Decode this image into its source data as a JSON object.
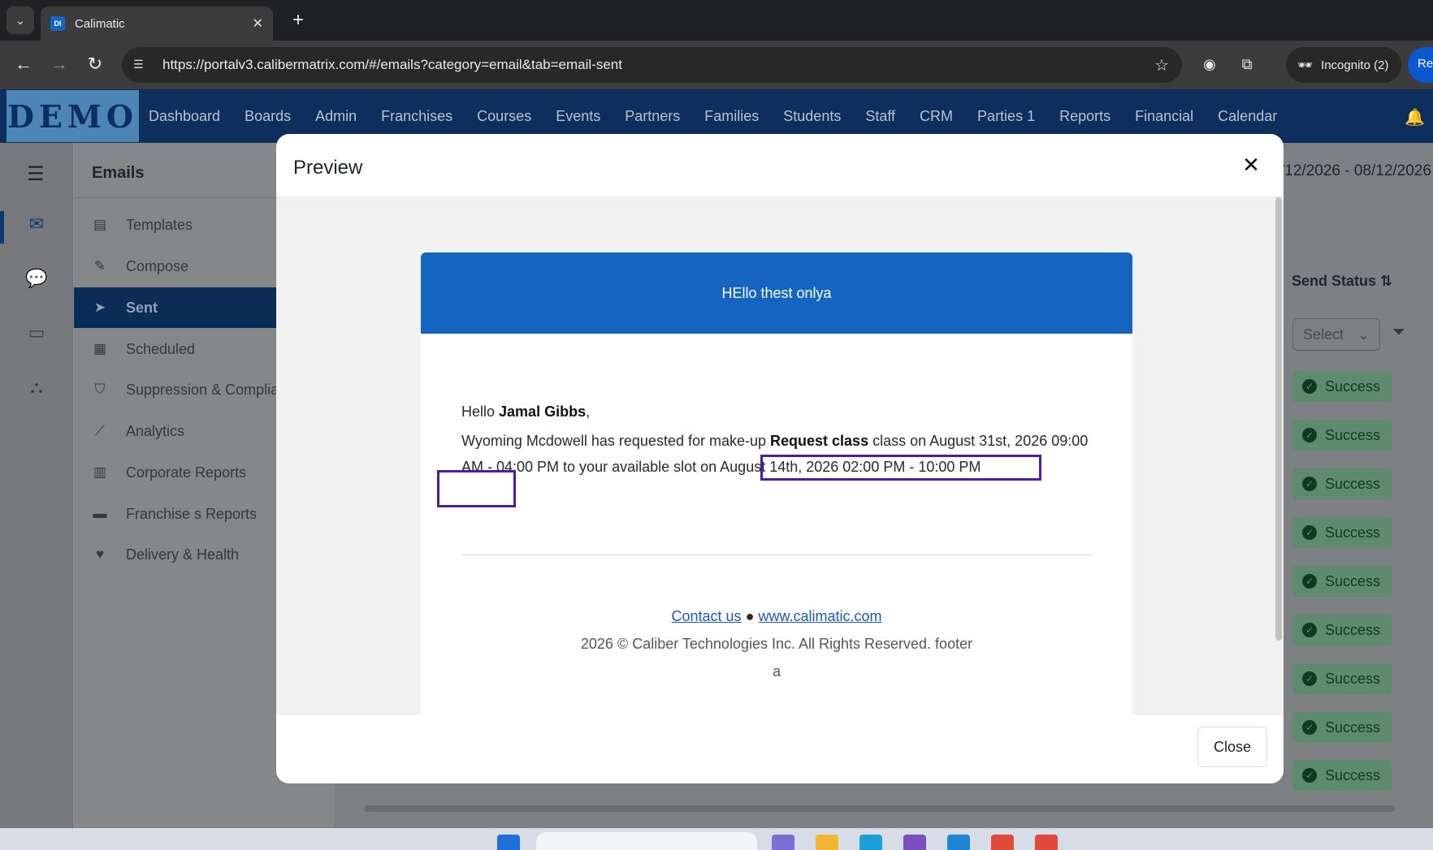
{
  "browser": {
    "tab_title": "Calimatic",
    "url": "https://portalv3.calibermatrix.com/#/emails?category=email&tab=email-sent",
    "incognito_label": "Incognito (2)",
    "relaunch_label": "Re"
  },
  "app": {
    "logo_text": "DEMO",
    "nav": [
      "Dashboard",
      "Boards",
      "Admin",
      "Franchises",
      "Courses",
      "Events",
      "Partners",
      "Families",
      "Students",
      "Staff",
      "CRM",
      "Parties 1",
      "Reports",
      "Financial",
      "Calendar"
    ]
  },
  "sidebar": {
    "title": "Emails",
    "items": [
      {
        "label": "Templates",
        "icon": "file-icon"
      },
      {
        "label": "Compose",
        "icon": "edit-icon"
      },
      {
        "label": "Sent",
        "icon": "paper-plane-icon",
        "active": true
      },
      {
        "label": "Scheduled",
        "icon": "calendar-icon"
      },
      {
        "label": "Suppression & Complia",
        "icon": "shield-icon"
      },
      {
        "label": "Analytics",
        "icon": "chart-line-icon"
      },
      {
        "label": "Corporate Reports",
        "icon": "building-icon"
      },
      {
        "label": "Franchise s Reports",
        "icon": "store-icon"
      },
      {
        "label": "Delivery & Health",
        "icon": "heartbeat-icon"
      }
    ]
  },
  "background_page": {
    "date_range": "/12/2026 - 08/12/2026",
    "column_header": "Send Status",
    "filter_placeholder": "Select",
    "status_values": [
      "Success",
      "Success",
      "Success",
      "Success",
      "Success",
      "Success",
      "Success",
      "Success",
      "Success"
    ]
  },
  "modal": {
    "title": "Preview",
    "close_button": "Close",
    "email": {
      "banner_text": "HEllo thest onlya",
      "greeting_prefix": "Hello ",
      "recipient_name": "Jamal Gibbs",
      "greeting_suffix": ",",
      "message_part1": "Wyoming Mcdowell has requested for make-up ",
      "message_bold": "Request class",
      "message_part2": " class on August 31st, 2026 09:00 AM - 04:00 PM to your available slot on August 14th, 2026 02:00 PM - 10:00 PM",
      "contact_link": "Contact us",
      "separator": "●",
      "website_link": "www.calimatic.com",
      "copyright": "2026 © Caliber Technologies Inc. All Rights Reserved. footer",
      "footer_extra": "a"
    }
  }
}
